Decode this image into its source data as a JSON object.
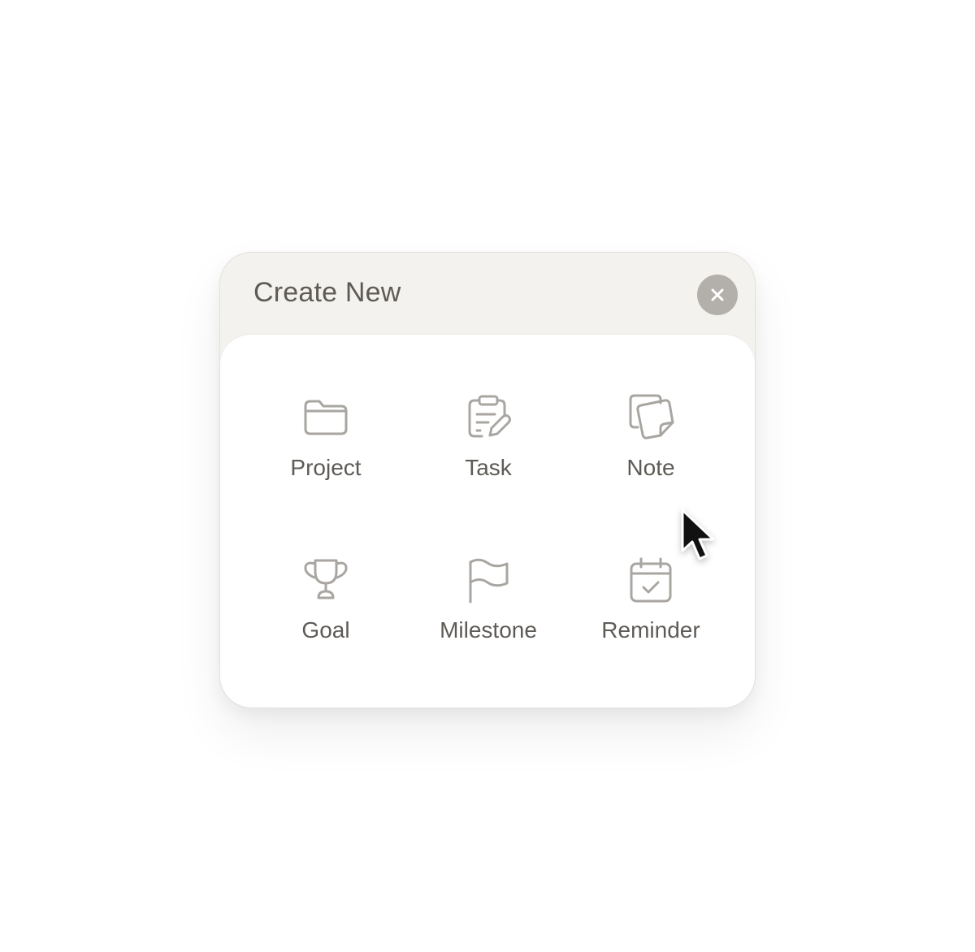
{
  "dialog": {
    "title": "Create New",
    "close_icon": "close-icon"
  },
  "items": [
    {
      "label": "Project",
      "icon": "folder-icon"
    },
    {
      "label": "Task",
      "icon": "clipboard-edit-icon"
    },
    {
      "label": "Note",
      "icon": "notes-stack-icon"
    },
    {
      "label": "Goal",
      "icon": "trophy-icon"
    },
    {
      "label": "Milestone",
      "icon": "flag-icon"
    },
    {
      "label": "Reminder",
      "icon": "calendar-check-icon"
    }
  ],
  "colors": {
    "header_bg": "#f4f2ee",
    "panel_bg": "#ffffff",
    "text": "#5e5b57",
    "icon_stroke": "#a9a6a1",
    "close_bg": "#b3b0ab"
  }
}
